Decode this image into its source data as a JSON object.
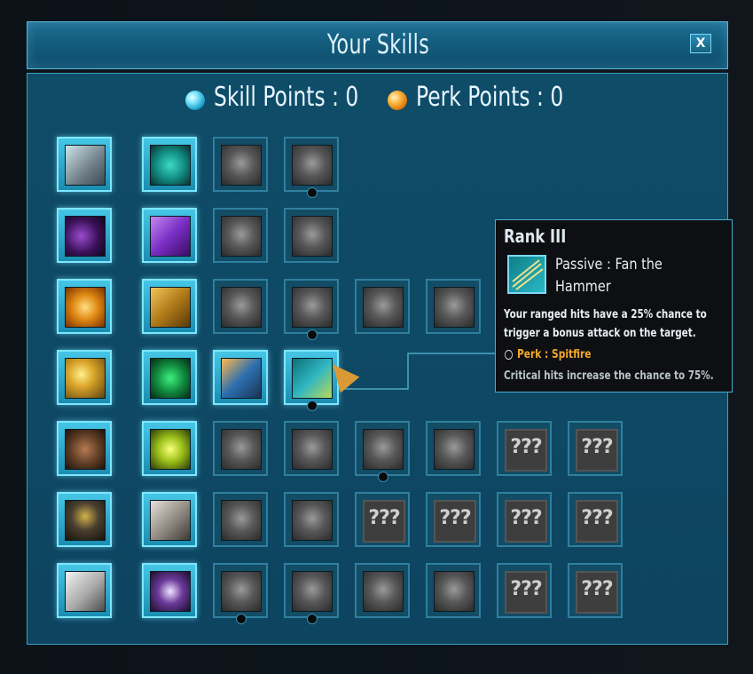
{
  "window": {
    "title": "Your Skills",
    "close_label": "X"
  },
  "points": {
    "skill_label": "Skill Points : 0",
    "perk_label": "Perk Points : 0"
  },
  "colors": {
    "accent": "#46c6e6",
    "panel": "#0e4864",
    "perk": "#f3a82a"
  },
  "grid": [
    [
      {
        "state": "active",
        "icon": "spiked-mace-icon"
      },
      {
        "state": "active",
        "icon": "spiked-ball-icon"
      },
      {
        "state": "inactive",
        "icon": "crossed-blades-icon"
      },
      {
        "state": "inactive",
        "icon": "chain-shackles-icon",
        "dot": true
      }
    ],
    [
      {
        "state": "active",
        "icon": "shadow-fiend-icon"
      },
      {
        "state": "active",
        "icon": "purple-dragon-icon"
      },
      {
        "state": "inactive",
        "icon": "castle-tower-icon"
      },
      {
        "state": "inactive",
        "icon": "question-rune-icon"
      }
    ],
    [
      {
        "state": "active",
        "icon": "fire-totem-icon"
      },
      {
        "state": "active",
        "icon": "dual-pistols-icon"
      },
      {
        "state": "inactive",
        "icon": "pistol-blast-icon"
      },
      {
        "state": "inactive",
        "icon": "crosshair-icon",
        "dot": true
      },
      {
        "state": "inactive",
        "icon": "skull-face-icon"
      },
      {
        "state": "inactive",
        "icon": "demon-head-icon"
      }
    ],
    [
      {
        "state": "active",
        "icon": "gun-fire-icon"
      },
      {
        "state": "active",
        "icon": "green-scope-icon"
      },
      {
        "state": "active",
        "icon": "rifle-target-icon"
      },
      {
        "state": "active",
        "icon": "fan-hammer-icon",
        "dot": true
      }
    ],
    [
      {
        "state": "active",
        "icon": "armored-brute-icon"
      },
      {
        "state": "active",
        "icon": "glowing-golem-icon"
      },
      {
        "state": "inactive",
        "icon": "beast-shield-icon"
      },
      {
        "state": "inactive",
        "icon": "wind-swirl-icon"
      },
      {
        "state": "inactive",
        "icon": "war-hammer-icon",
        "dot": true
      },
      {
        "state": "inactive",
        "icon": "round-shield-icon"
      },
      {
        "state": "inactive",
        "icon": "locked-icon",
        "label": "???"
      },
      {
        "state": "inactive",
        "icon": "locked-icon",
        "label": "???"
      }
    ],
    [
      {
        "state": "active",
        "icon": "hooded-rogue-icon"
      },
      {
        "state": "active",
        "icon": "claw-hand-icon"
      },
      {
        "state": "inactive",
        "icon": "shadow-figure-icon"
      },
      {
        "state": "inactive",
        "icon": "burst-face-icon"
      },
      {
        "state": "inactive",
        "icon": "locked-icon",
        "label": "???"
      },
      {
        "state": "inactive",
        "icon": "locked-icon",
        "label": "???"
      },
      {
        "state": "inactive",
        "icon": "locked-icon",
        "label": "???"
      },
      {
        "state": "inactive",
        "icon": "locked-icon",
        "label": "???"
      }
    ],
    [
      {
        "state": "active",
        "icon": "white-hood-icon"
      },
      {
        "state": "active",
        "icon": "skull-bomb-icon"
      },
      {
        "state": "inactive",
        "icon": "bomb-icon",
        "dot": true
      },
      {
        "state": "inactive",
        "icon": "explosion-icon",
        "dot": true
      },
      {
        "state": "inactive",
        "icon": "grenade-icon"
      },
      {
        "state": "inactive",
        "icon": "mine-icon"
      },
      {
        "state": "inactive",
        "icon": "locked-icon",
        "label": "???"
      },
      {
        "state": "inactive",
        "icon": "locked-icon",
        "label": "???"
      }
    ]
  ],
  "tooltip": {
    "rank": "Rank III",
    "icon": "fan-hammer-icon",
    "name": "Passive : Fan the Hammer",
    "desc_line1": "Your ranged hits have a 25% chance to",
    "desc_line2": "trigger a bonus attack on the target.",
    "perk": "Perk : Spitfire",
    "crit": "Critical hits increase the chance to 75%."
  }
}
